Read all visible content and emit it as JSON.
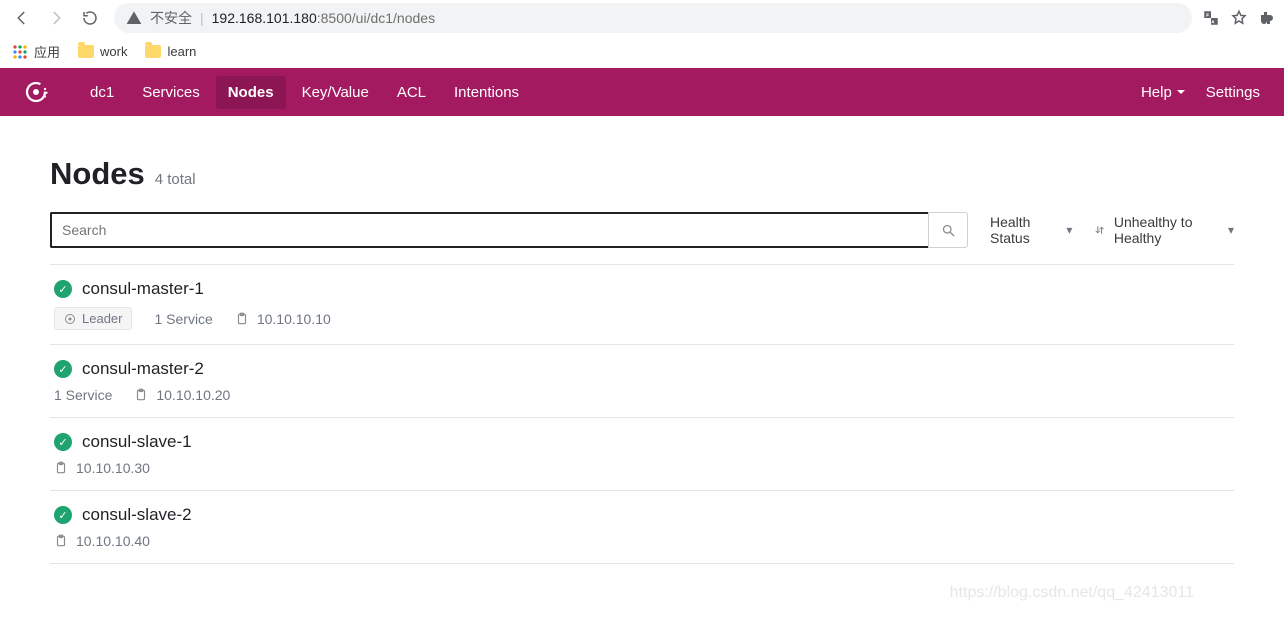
{
  "browser": {
    "not_secure_label": "不安全",
    "url_host": "192.168.101.180",
    "url_port": ":8500",
    "url_path": "/ui/dc1/nodes"
  },
  "bookmarks": {
    "apps_label": "应用",
    "items": [
      {
        "label": "work"
      },
      {
        "label": "learn"
      }
    ]
  },
  "nav": {
    "dc": "dc1",
    "links": [
      {
        "label": "Services",
        "active": false
      },
      {
        "label": "Nodes",
        "active": true
      },
      {
        "label": "Key/Value",
        "active": false
      },
      {
        "label": "ACL",
        "active": false
      },
      {
        "label": "Intentions",
        "active": false
      }
    ],
    "help_label": "Help",
    "settings_label": "Settings"
  },
  "page": {
    "title": "Nodes",
    "subtitle": "4 total",
    "search_placeholder": "Search",
    "filter_health": "Health Status",
    "sort_label": "Unhealthy to Healthy"
  },
  "nodes": [
    {
      "name": "consul-master-1",
      "leader": true,
      "leader_label": "Leader",
      "services_label": "1 Service",
      "address": "10.10.10.10"
    },
    {
      "name": "consul-master-2",
      "leader": false,
      "services_label": "1 Service",
      "address": "10.10.10.20"
    },
    {
      "name": "consul-slave-1",
      "leader": false,
      "services_label": "",
      "address": "10.10.10.30"
    },
    {
      "name": "consul-slave-2",
      "leader": false,
      "services_label": "",
      "address": "10.10.10.40"
    }
  ],
  "watermark": "https://blog.csdn.net/qq_42413011",
  "colors": {
    "accent": "#a31a60",
    "healthy": "#1ea371"
  }
}
